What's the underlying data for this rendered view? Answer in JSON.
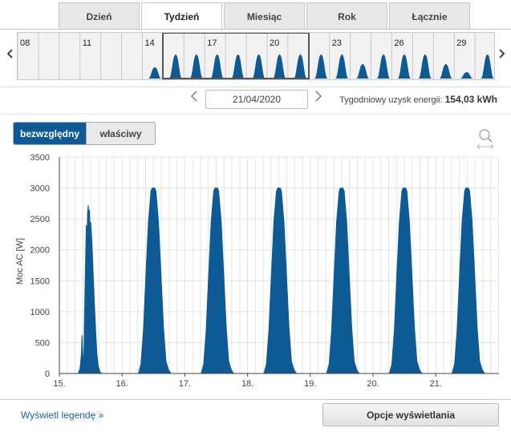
{
  "tabs": [
    {
      "label": "Dzień",
      "active": false
    },
    {
      "label": "Tydzień",
      "active": true
    },
    {
      "label": "Miesiąc",
      "active": false
    },
    {
      "label": "Rok",
      "active": false
    },
    {
      "label": "Łącznie",
      "active": false
    }
  ],
  "timeline": {
    "day_labels": [
      "08",
      "11",
      "14",
      "17",
      "20",
      "23",
      "26",
      "29"
    ],
    "prev_icon": "chevron-left-icon",
    "next_icon": "chevron-right-icon"
  },
  "date_nav": {
    "date": "21/04/2020",
    "energy_label": "Tygodniowy uzysk energii:",
    "energy_value": "154,03 kWh"
  },
  "toggle": {
    "absolute": "bezwzględny",
    "relative": "właściwy",
    "selected": "absolute"
  },
  "zoom_icon": "magnifier-icon",
  "colors": {
    "series": "#0e5a95",
    "accent": "#0e5a95"
  },
  "chart_data": {
    "type": "area",
    "ylabel": "Moc AC [W]",
    "ylim": [
      0,
      3500
    ],
    "yticks": [
      0,
      500,
      1000,
      1500,
      2000,
      2500,
      3000,
      3500
    ],
    "xticks": [
      "15.",
      "16.",
      "17.",
      "18.",
      "19.",
      "20.",
      "21."
    ],
    "grid": true,
    "series": [
      {
        "days": [
          "15.",
          "16.",
          "17.",
          "18.",
          "19.",
          "20.",
          "21."
        ],
        "peak_w": [
          2720,
          3000,
          3000,
          3000,
          3000,
          3000,
          3000
        ]
      }
    ]
  },
  "footer": {
    "legend_link": "Wyświetl legendę »",
    "options_button": "Opcje wyświetlania"
  }
}
